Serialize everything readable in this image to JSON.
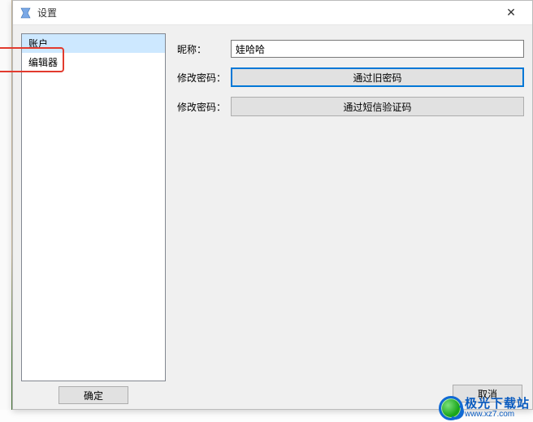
{
  "window": {
    "title": "设置",
    "close_glyph": "✕"
  },
  "sidebar": {
    "items": [
      {
        "label": "账户",
        "selected": true
      },
      {
        "label": "编辑器",
        "selected": false
      }
    ],
    "confirm_label": "确定"
  },
  "form": {
    "nickname": {
      "label": "昵称：",
      "value": "娃哈哈"
    },
    "change1": {
      "label": "修改密码：",
      "button": "通过旧密码"
    },
    "change2": {
      "label": "修改密码：",
      "button": "通过短信验证码"
    }
  },
  "footer": {
    "cancel_label": "取消"
  },
  "watermark": {
    "main": "极光下载站",
    "sub": "www.xz7.com"
  },
  "colors": {
    "selection": "#cde8ff",
    "accent": "#0078d7",
    "highlight_box": "#e23b2e"
  }
}
